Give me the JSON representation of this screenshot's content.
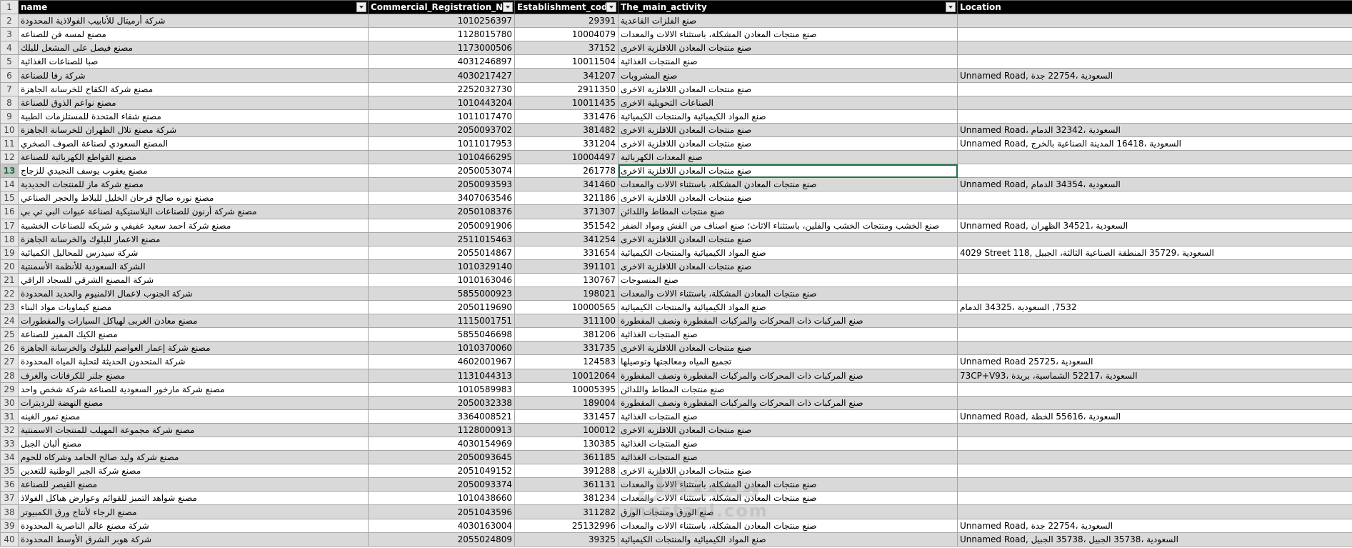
{
  "headers": {
    "name": "name",
    "crn": "Commercial_Registration_No",
    "est": "Establishment_code",
    "act": "The_main_activity",
    "loc": "Location"
  },
  "watermark": {
    "main": "مستقل",
    "sub": "mostaql.com"
  },
  "selected_row": 13,
  "rows": [
    {
      "n": "2",
      "name": "شركة أرميتال للأنابيب الفولاذية المحدودة",
      "crn": "1010256397",
      "est": "29391",
      "act": "صنع الفلزات القاعدية",
      "loc": ""
    },
    {
      "n": "3",
      "name": "مصنع لمسه فن للصناعه",
      "crn": "1128015780",
      "est": "10004079",
      "act": "صنع منتجات المعادن المشكلة، باستثناء الالات والمعدات",
      "loc": ""
    },
    {
      "n": "4",
      "name": "مصنع فيصل على المشعل للبلك",
      "crn": "1173000506",
      "est": "37152",
      "act": "صنع منتجات المعادن اللافلزية الاخرى",
      "loc": ""
    },
    {
      "n": "5",
      "name": "صبا للصناعات الغذائية",
      "crn": "4031246897",
      "est": "10011504",
      "act": "صنع المنتجات الغذائية",
      "loc": ""
    },
    {
      "n": "6",
      "name": "شركة رفا للصناعة",
      "crn": "4030217427",
      "est": "341207",
      "act": "صنع المشروبات",
      "loc": "Unnamed Road, السعودية ،22754 جدة"
    },
    {
      "n": "7",
      "name": "مصنع شركة الكفاح للخرسانة الجاهزة",
      "crn": "2252032730",
      "est": "2911350",
      "act": "صنع منتجات المعادن اللافلزية الاخرى",
      "loc": ""
    },
    {
      "n": "8",
      "name": "مصنع نواعم الذوق للصناعة",
      "crn": "1010443204",
      "est": "10011435",
      "act": "الصناعات التحويلية الاخرى",
      "loc": ""
    },
    {
      "n": "9",
      "name": "مصنع شفاء المتحدة للمستلزمات الطبية",
      "crn": "1011017470",
      "est": "331476",
      "act": "صنع المواد الكيميائية والمنتجات الكيميائية",
      "loc": ""
    },
    {
      "n": "10",
      "name": "شركة مصنع تلال الظهران للخرسانة الجاهزة",
      "crn": "2050093702",
      "est": "381482",
      "act": "صنع منتجات المعادن اللافلزية الاخرى",
      "loc": "Unnamed Road، السعودية ،32342 الدمام"
    },
    {
      "n": "11",
      "name": "المصنع السعودي لصناعة الصوف الصخري",
      "crn": "1011017953",
      "est": "331204",
      "act": "صنع منتجات المعادن اللافلزية الاخرى",
      "loc": "Unnamed Road, السعودية ،16418 المدينة الصناعية بالخرج"
    },
    {
      "n": "12",
      "name": "مصنع القواطع الكهربائية للصناعة",
      "crn": "1010466295",
      "est": "10004497",
      "act": "صنع المعدات الكهربائية",
      "loc": ""
    },
    {
      "n": "13",
      "name": "مصنع يعقوب يوسف النجيدي للزجاج",
      "crn": "2050053074",
      "est": "261778",
      "act": "صنع منتجات المعادن اللافلزية الاخرى",
      "loc": ""
    },
    {
      "n": "14",
      "name": "مصنع شركة ماز للمنتجات الحديدية",
      "crn": "2050093593",
      "est": "341460",
      "act": "صنع منتجات المعادن المشكلة، باستثناء الالات والمعدات",
      "loc": "Unnamed Road, السعودية ،34354 الدمام"
    },
    {
      "n": "15",
      "name": "مصنع نوره صالح فرحان الخليل للبلاط والحجر الصناعي",
      "crn": "3407063546",
      "est": "321186",
      "act": "صنع منتجات المعادن اللافلزية الاخرى",
      "loc": ""
    },
    {
      "n": "16",
      "name": "مصنع شركة أرنون للصناعات البلاستيكية لصناعة عبوات البي تي بي",
      "crn": "2050108376",
      "est": "371307",
      "act": "صنع منتجات المطاط واللدائن",
      "loc": ""
    },
    {
      "n": "17",
      "name": "مصنع شركة احمد سعيد عفيفي و شريكه للصناعات الخشبية",
      "crn": "2050091906",
      "est": "351542",
      "act": "صنع الخشب ومنتجات الخشب والفلين، باستثناء الاثاث؛ صنع اصناف من القش ومواد الضفر",
      "loc": "Unnamed Road, السعودية ،34521 الظهران"
    },
    {
      "n": "18",
      "name": "مصنع الاعمار للبلوك والخرسانة الجاهزة",
      "crn": "2511015463",
      "est": "341254",
      "act": "صنع منتجات المعادن اللافلزية الاخرى",
      "loc": ""
    },
    {
      "n": "19",
      "name": "شركة سيدرس للمحاليل الكميائية",
      "crn": "2055014867",
      "est": "331654",
      "act": "صنع المواد الكيميائية والمنتجات الكيميائية",
      "loc": "4029 Street 118, السعودية ،35729 المنطقة الصناعية الثالثة، الجبيل"
    },
    {
      "n": "20",
      "name": "الشركة السعودية للأنظمة الأسمنتية",
      "crn": "1010329140",
      "est": "391101",
      "act": "صنع منتجات المعادن اللافلزية الاخرى",
      "loc": ""
    },
    {
      "n": "21",
      "name": "شركة المصنع الشرقي للسجاد الراقي",
      "crn": "1010163046",
      "est": "130767",
      "act": "صنع المنسوجات",
      "loc": ""
    },
    {
      "n": "22",
      "name": "شركة الجنوب لاعمال الالمنيوم والحديد المحدودة",
      "crn": "5855000923",
      "est": "198021",
      "act": "صنع منتجات المعادن المشكلة، باستثناء الالات والمعدات",
      "loc": ""
    },
    {
      "n": "23",
      "name": "مصنع كيماويات مواد البناء",
      "crn": "2050119690",
      "est": "10000565",
      "act": "صنع المواد الكيميائية والمنتجات الكيميائية",
      "loc": "7532, السعودية ،34325 الدمام"
    },
    {
      "n": "24",
      "name": "مصنع معادن الغربى لهياكل السيارات والمقطورات",
      "crn": "1115001751",
      "est": "311100",
      "act": "صنع المركبات ذات المحركات والمركبات المقطورة ونصف المقطورة",
      "loc": ""
    },
    {
      "n": "25",
      "name": "مصنع الكيك المميز للصناعة",
      "crn": "5855046698",
      "est": "381206",
      "act": "صنع المنتجات الغذائية",
      "loc": ""
    },
    {
      "n": "26",
      "name": "مصنع شركة إعمار العواصم للبلوك والخرسانة الجاهزة",
      "crn": "1010370060",
      "est": "331735",
      "act": "صنع منتجات المعادن اللافلزية الاخرى",
      "loc": ""
    },
    {
      "n": "27",
      "name": "شركة المتحدون الحديثة لتحلية المياه المحدودة",
      "crn": "4602001967",
      "est": "124583",
      "act": "تجميع المياه ومعالجتها وتوصيلها",
      "loc": "Unnamed Road 25725، السعودية"
    },
    {
      "n": "28",
      "name": "مصنع جلنر للكرفانات والغرف",
      "crn": "1131044313",
      "est": "10012064",
      "act": "صنع المركبات ذات المحركات والمركبات المقطورة ونصف المقطورة",
      "loc": "73CP+V93، السعودية ،52217 الشماسية، بريدة"
    },
    {
      "n": "29",
      "name": "مصنع شركة مارخور السعودية للصناعة شركة شخص واحد",
      "crn": "1010589983",
      "est": "10005395",
      "act": "صنع منتجات المطاط واللدائن",
      "loc": ""
    },
    {
      "n": "30",
      "name": "مصنع النهضة للرديترات",
      "crn": "2050032338",
      "est": "189004",
      "act": "صنع المركبات ذات المحركات والمركبات المقطورة ونصف المقطورة",
      "loc": ""
    },
    {
      "n": "31",
      "name": "مصنع تمور الغينه",
      "crn": "3364008521",
      "est": "331457",
      "act": "صنع المنتجات الغذائية",
      "loc": "Unnamed Road, السعودية ،55616 الخطة"
    },
    {
      "n": "32",
      "name": "مصنع شركة مجموعة المهيلب للمنتجات الاسمنتية",
      "crn": "1128000913",
      "est": "100012",
      "act": "صنع منتجات المعادن اللافلزية الاخرى",
      "loc": ""
    },
    {
      "n": "33",
      "name": "مصنع ألبان الجبل",
      "crn": "4030154969",
      "est": "130385",
      "act": "صنع المنتجات الغذائية",
      "loc": ""
    },
    {
      "n": "34",
      "name": "مصنع شركة وليد صالح الحامد وشركاه للحوم",
      "crn": "2050093645",
      "est": "361185",
      "act": "صنع المنتجات الغذائية",
      "loc": ""
    },
    {
      "n": "35",
      "name": "مصنع شركة الجبر الوطنية للتعدين",
      "crn": "2051049152",
      "est": "391288",
      "act": "صنع منتجات المعادن اللافلزية الاخرى",
      "loc": ""
    },
    {
      "n": "36",
      "name": "مصنع القيصر للصناعة",
      "crn": "2050093374",
      "est": "361131",
      "act": "صنع منتجات المعادن المشكلة، باستثناء الالات والمعدات",
      "loc": ""
    },
    {
      "n": "37",
      "name": "مصنع شواهد التميز للقوائم وعوارض هياكل الفولاذ",
      "crn": "1010438660",
      "est": "381234",
      "act": "صنع منتجات المعادن المشكلة، باستثناء الالات والمعدات",
      "loc": ""
    },
    {
      "n": "38",
      "name": "مصنع الرجاء لأنتاج ورق الكمبيوتر",
      "crn": "2051043596",
      "est": "311282",
      "act": "صنع الورق ومنتجات الورق",
      "loc": ""
    },
    {
      "n": "39",
      "name": "شركة مصنع عالم الناصرية المحدودة",
      "crn": "4030163004",
      "est": "25132996",
      "act": "صنع منتجات المعادن المشكلة، باستثناء الالات والمعدات",
      "loc": "Unnamed Road, السعودية ،22754 جدة"
    },
    {
      "n": "40",
      "name": "شركة هوبر الشرق الأوسط المحدودة",
      "crn": "2055024809",
      "est": "39325",
      "act": "صنع المواد الكيميائية والمنتجات الكيميائية",
      "loc": "Unnamed Road, السعودية ،35738 الجبيل ،35738 الجبيل"
    }
  ]
}
